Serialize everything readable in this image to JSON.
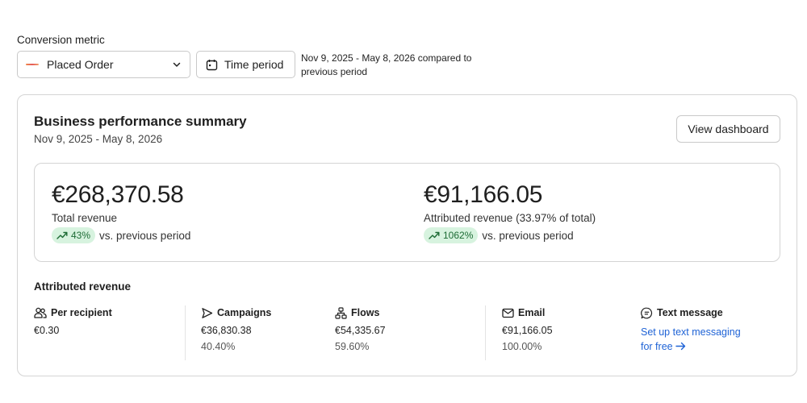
{
  "conversion_metric": {
    "label": "Conversion metric",
    "selected": "Placed Order"
  },
  "time_period": {
    "button_label": "Time period",
    "description": "Nov 9, 2025 - May 8, 2026 compared to previous period"
  },
  "summary": {
    "title": "Business performance summary",
    "date_range": "Nov 9, 2025 - May 8, 2026",
    "view_dashboard_label": "View dashboard",
    "total_revenue": {
      "amount": "€268,370.58",
      "label": "Total revenue",
      "change": "43%",
      "change_suffix": "vs. previous period"
    },
    "attributed_revenue": {
      "amount": "€91,166.05",
      "label": "Attributed revenue (33.97% of total)",
      "change": "1062%",
      "change_suffix": "vs. previous period"
    }
  },
  "attributed": {
    "title": "Attributed revenue",
    "per_recipient": {
      "label": "Per recipient",
      "value": "€0.30"
    },
    "campaigns": {
      "label": "Campaigns",
      "value": "€36,830.38",
      "percent": "40.40%"
    },
    "flows": {
      "label": "Flows",
      "value": "€54,335.67",
      "percent": "59.60%"
    },
    "email": {
      "label": "Email",
      "value": "€91,166.05",
      "percent": "100.00%"
    },
    "text_message": {
      "label": "Text message",
      "link_line1": "Set up text messaging",
      "link_line2": "for free"
    }
  },
  "colors": {
    "positive_badge_bg": "#d7f3df",
    "positive_badge_text": "#1c6b34",
    "link": "#1f63d6"
  }
}
